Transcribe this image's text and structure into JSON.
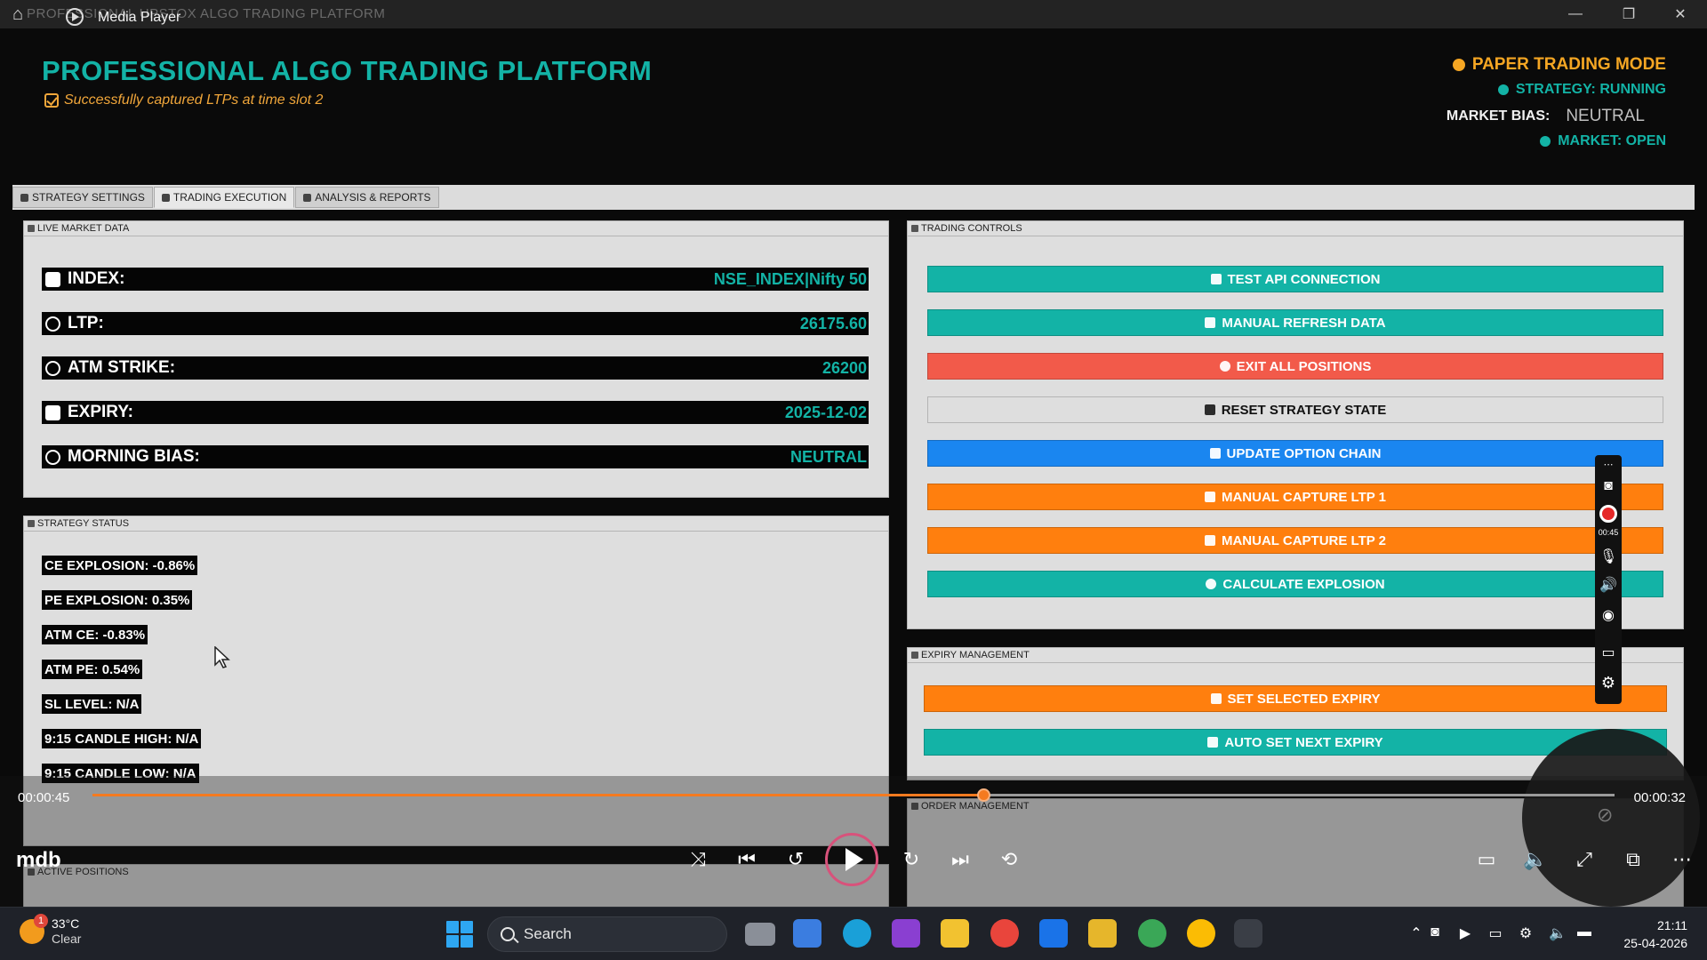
{
  "player": {
    "ghost_title": "PROFESSIONAL UPSTOX ALGO TRADING PLATFORM",
    "title": "Media Player",
    "time_elapsed": "00:00:45",
    "time_remaining": "00:00:32",
    "progress_fraction": 0.585,
    "watermark": "mdb",
    "accent": "#f57a1f"
  },
  "header": {
    "title": "PROFESSIONAL ALGO TRADING PLATFORM",
    "subtitle": "Successfully captured LTPs at time slot 2",
    "mode": "PAPER TRADING MODE",
    "strategy_status": "STRATEGY: RUNNING",
    "market_bias_label": "MARKET BIAS:",
    "market_bias_value": "NEUTRAL",
    "market_status": "MARKET: OPEN"
  },
  "tabs": [
    {
      "label": "STRATEGY SETTINGS"
    },
    {
      "label": "TRADING EXECUTION"
    },
    {
      "label": "ANALYSIS & REPORTS"
    }
  ],
  "live_market": {
    "label": "LIVE MARKET DATA",
    "rows": [
      {
        "label": "INDEX:",
        "value": "NSE_INDEX|Nifty 50"
      },
      {
        "label": "LTP:",
        "value": "26175.60"
      },
      {
        "label": "ATM STRIKE:",
        "value": "26200"
      },
      {
        "label": "EXPIRY:",
        "value": "2025-12-02"
      },
      {
        "label": "MORNING BIAS:",
        "value": "NEUTRAL"
      }
    ]
  },
  "strategy_status": {
    "label": "STRATEGY STATUS",
    "items": [
      "CE EXPLOSION: -0.86%",
      "PE EXPLOSION: 0.35%",
      "ATM CE: -0.83%",
      "ATM PE: 0.54%",
      "SL LEVEL: N/A",
      "9:15 CANDLE HIGH: N/A",
      "9:15 CANDLE LOW: N/A"
    ]
  },
  "active_positions": {
    "label": "ACTIVE POSITIONS"
  },
  "trading_controls": {
    "label": "TRADING CONTROLS",
    "buttons": [
      {
        "label": "TEST API CONNECTION",
        "color": "#13b3a6"
      },
      {
        "label": "MANUAL REFRESH DATA",
        "color": "#13b3a6"
      },
      {
        "label": "EXIT ALL POSITIONS",
        "color": "#f25a4a"
      },
      {
        "label": "RESET STRATEGY STATE",
        "color": "#dedede"
      },
      {
        "label": "UPDATE OPTION CHAIN",
        "color": "#1a86f0"
      },
      {
        "label": "MANUAL CAPTURE LTP 1",
        "color": "#ff7f0e"
      },
      {
        "label": "MANUAL CAPTURE LTP 2",
        "color": "#ff7f0e"
      },
      {
        "label": "CALCULATE EXPLOSION",
        "color": "#13b3a6"
      }
    ]
  },
  "expiry_management": {
    "label": "EXPIRY MANAGEMENT",
    "buttons": [
      {
        "label": "SET SELECTED EXPIRY",
        "color": "#ff7f0e"
      },
      {
        "label": "AUTO SET NEXT EXPIRY",
        "color": "#13b3a6"
      }
    ]
  },
  "order_management": {
    "label": "ORDER MANAGEMENT"
  },
  "recorder": {
    "timer": "00:45"
  },
  "taskbar": {
    "temperature": "33°C",
    "weather": "Clear",
    "weather_badge": "1",
    "search_label": "Search",
    "time": "21:11",
    "date": "25-04-2026"
  }
}
